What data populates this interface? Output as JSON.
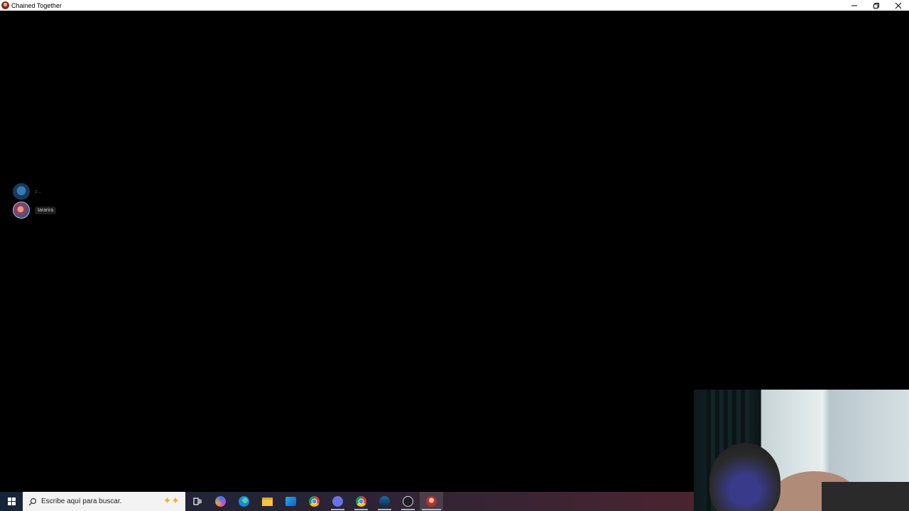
{
  "window": {
    "title": "Chained Together",
    "icon": "chained-together-app-icon",
    "controls": [
      "minimize-icon",
      "restore-icon",
      "close-icon"
    ]
  },
  "voice_overlay": {
    "users": [
      {
        "name": "z...",
        "avatar": "avatar-blue-bird-icon",
        "speaking": false
      },
      {
        "name": "tararira",
        "avatar": "avatar-colorful-icon",
        "speaking": false
      }
    ]
  },
  "taskbar": {
    "search_placeholder": "Escribe aquí para buscar.",
    "apps": [
      {
        "name": "task-view-icon",
        "running": false
      },
      {
        "name": "copilot-icon",
        "running": false
      },
      {
        "name": "edge-icon",
        "running": false
      },
      {
        "name": "file-explorer-icon",
        "running": false
      },
      {
        "name": "outlook-icon",
        "running": false
      },
      {
        "name": "chrome-icon",
        "running": false
      },
      {
        "name": "discord-icon",
        "running": true
      },
      {
        "name": "chrome-profile-icon",
        "running": true
      },
      {
        "name": "steam-icon",
        "running": true
      },
      {
        "name": "obs-icon",
        "running": true
      },
      {
        "name": "chained-together-icon",
        "running": true,
        "active": true
      }
    ]
  },
  "webcam": {
    "label": "webcam-overlay"
  }
}
